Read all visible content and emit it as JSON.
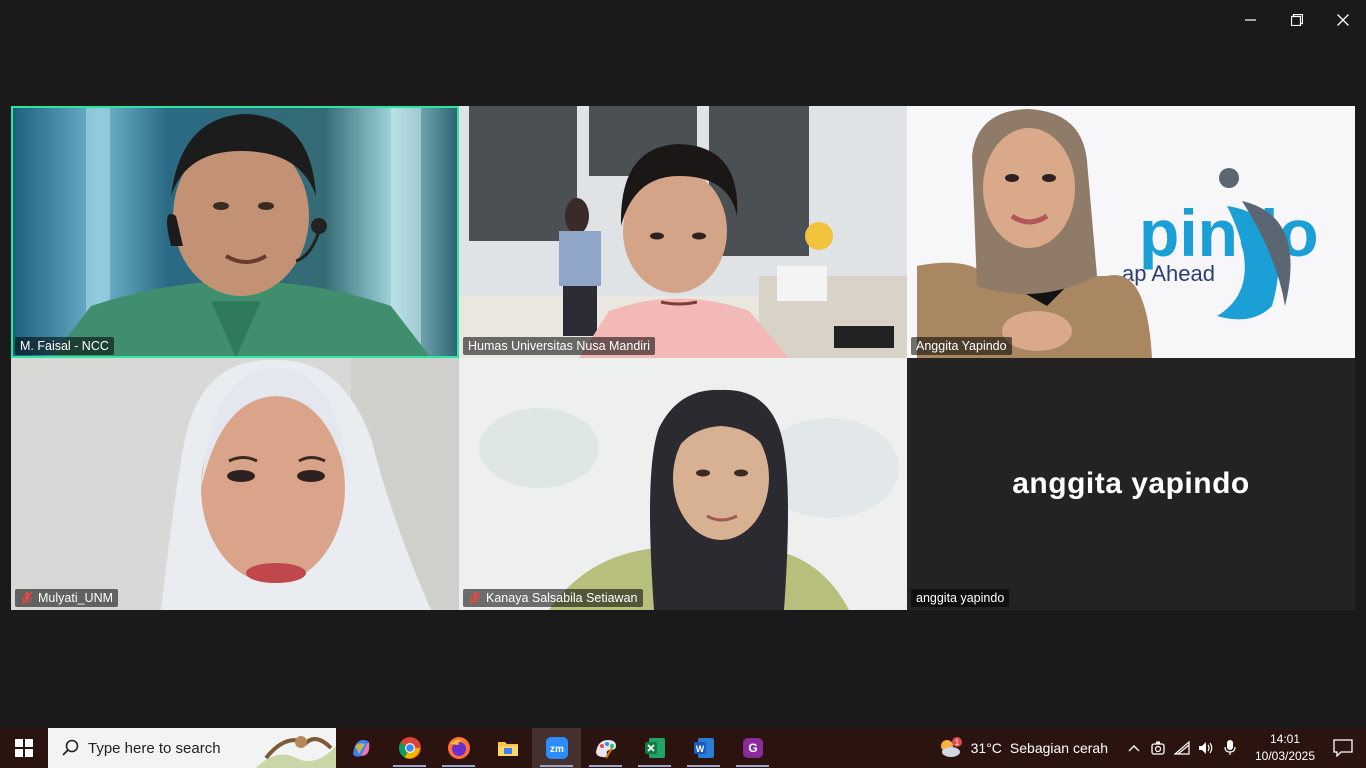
{
  "window": {
    "controls": [
      "minimize",
      "restore",
      "close"
    ]
  },
  "participants": [
    {
      "name": "M. Faisal - NCC",
      "muted": false,
      "active_speaker": true
    },
    {
      "name": "Humas Universitas Nusa Mandiri",
      "muted": false,
      "active_speaker": false
    },
    {
      "name": "Anggita Yapindo",
      "muted": false,
      "active_speaker": false,
      "logo_text": "pindo",
      "logo_sub": "ap Ahead"
    },
    {
      "name": "Mulyati_UNM",
      "muted": true,
      "active_speaker": false
    },
    {
      "name": "Kanaya Salsabila Setiawan",
      "muted": true,
      "active_speaker": false
    },
    {
      "name": "anggita yapindo",
      "muted": false,
      "active_speaker": false,
      "video_off_label": "anggita yapindo"
    }
  ],
  "taskbar": {
    "search_placeholder": "Type here to search",
    "apps": [
      "copilot-icon",
      "chrome-icon",
      "firefox-icon",
      "file-explorer-icon",
      "zoom-icon",
      "paint-icon",
      "excel-icon",
      "word-icon",
      "pdf-app-icon"
    ],
    "weather": {
      "temp": "31°C",
      "desc": "Sebagian cerah",
      "badge": "1"
    },
    "clock": {
      "time": "14:01",
      "date": "10/03/2025"
    }
  },
  "colors": {
    "active_speaker_border": "#2ee6a0",
    "taskbar_bg": "#2b1410"
  }
}
